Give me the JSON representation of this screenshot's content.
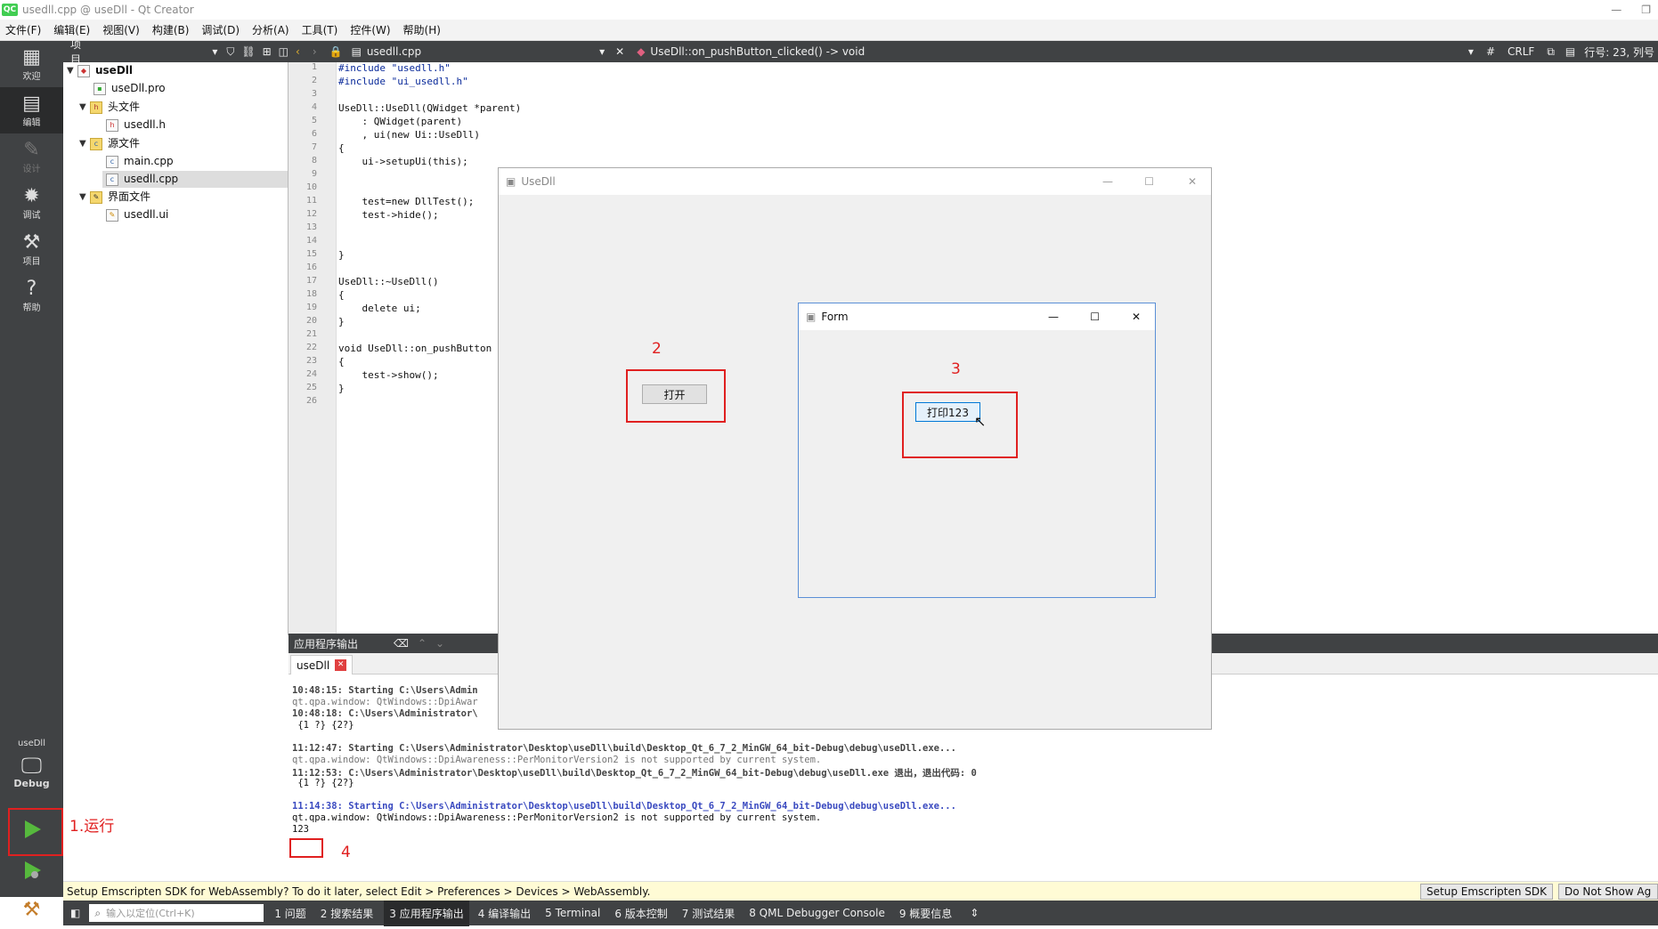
{
  "titlebar": {
    "logo": "QC",
    "title": "usedll.cpp @ useDll - Qt Creator"
  },
  "menu": [
    "文件(F)",
    "编辑(E)",
    "视图(V)",
    "构建(B)",
    "调试(D)",
    "分析(A)",
    "工具(T)",
    "控件(W)",
    "帮助(H)"
  ],
  "modes": [
    {
      "label": "欢迎",
      "icon": "grid-icon"
    },
    {
      "label": "编辑",
      "icon": "edit-icon"
    },
    {
      "label": "设计",
      "icon": "pencil-icon"
    },
    {
      "label": "调试",
      "icon": "bug-icon"
    },
    {
      "label": "项目",
      "icon": "wrench-icon"
    },
    {
      "label": "帮助",
      "icon": "help-icon"
    }
  ],
  "kit": {
    "project": "useDll",
    "mode": "Debug"
  },
  "project_panel": {
    "title": "项目"
  },
  "tree": {
    "root": "useDll",
    "pro": "useDll.pro",
    "headers": "头文件",
    "h1": "usedll.h",
    "sources": "源文件",
    "s1": "main.cpp",
    "s2": "usedll.cpp",
    "forms": "界面文件",
    "f1": "usedll.ui"
  },
  "editor": {
    "file": "usedll.cpp",
    "function": "UseDll::on_pushButton_clicked() -> void",
    "line_ending": "CRLF",
    "position": "行号: 23, 列号",
    "hash": "#",
    "lines": [
      "#include \"usedll.h\"",
      "#include \"ui_usedll.h\"",
      "",
      "UseDll::UseDll(QWidget *parent)",
      "    : QWidget(parent)",
      "    , ui(new Ui::UseDll)",
      "{",
      "    ui->setupUi(this);",
      "",
      "",
      "    test=new DllTest();",
      "    test->hide();",
      "",
      "",
      "}",
      "",
      "UseDll::~UseDll()",
      "{",
      "    delete ui;",
      "}",
      "",
      "void UseDll::on_pushButton",
      "{",
      "    test->show();",
      "}",
      ""
    ]
  },
  "output": {
    "panel_title": "应用程序输出",
    "tab": "useDll",
    "lines": [
      "10:48:15: Starting C:\\Users\\Admin",
      "qt.qpa.window: QtWindows::DpiAwar",
      "10:48:18: C:\\Users\\Administrator\\",
      " {1 ?} {2?}",
      "",
      "11:12:47: Starting C:\\Users\\Administrator\\Desktop\\useDll\\build\\Desktop_Qt_6_7_2_MinGW_64_bit-Debug\\debug\\useDll.exe...",
      "qt.qpa.window: QtWindows::DpiAwareness::PerMonitorVersion2 is not supported by current system.",
      "11:12:53: C:\\Users\\Administrator\\Desktop\\useDll\\build\\Desktop_Qt_6_7_2_MinGW_64_bit-Debug\\debug\\useDll.exe 退出，退出代码: 0",
      " {1 ?} {2?}",
      "",
      "11:14:38: Starting C:\\Users\\Administrator\\Desktop\\useDll\\build\\Desktop_Qt_6_7_2_MinGW_64_bit-Debug\\debug\\useDll.exe...",
      "qt.qpa.window: QtWindows::DpiAwareness::PerMonitorVersion2 is not supported by current system.",
      "123"
    ]
  },
  "notice": {
    "text": "Setup Emscripten SDK for WebAssembly? To do it later, select Edit > Preferences > Devices > WebAssembly.",
    "setup_button": "Setup Emscripten SDK",
    "dismiss_button": "Do Not Show Ag"
  },
  "statusbar": {
    "locator_placeholder": "输入以定位(Ctrl+K)",
    "tabs": [
      "1 问题",
      "2 搜索结果",
      "3 应用程序输出",
      "4 编译输出",
      "5 Terminal",
      "6 版本控制",
      "7 测试结果",
      "8 QML Debugger Console",
      "9 概要信息"
    ]
  },
  "usedll_window": {
    "title": "UseDll",
    "button": "打开"
  },
  "form_window": {
    "title": "Form",
    "button": "打印123"
  },
  "annotations": {
    "run": "1.运行",
    "n2": "2",
    "n3": "3",
    "n4": "4"
  }
}
